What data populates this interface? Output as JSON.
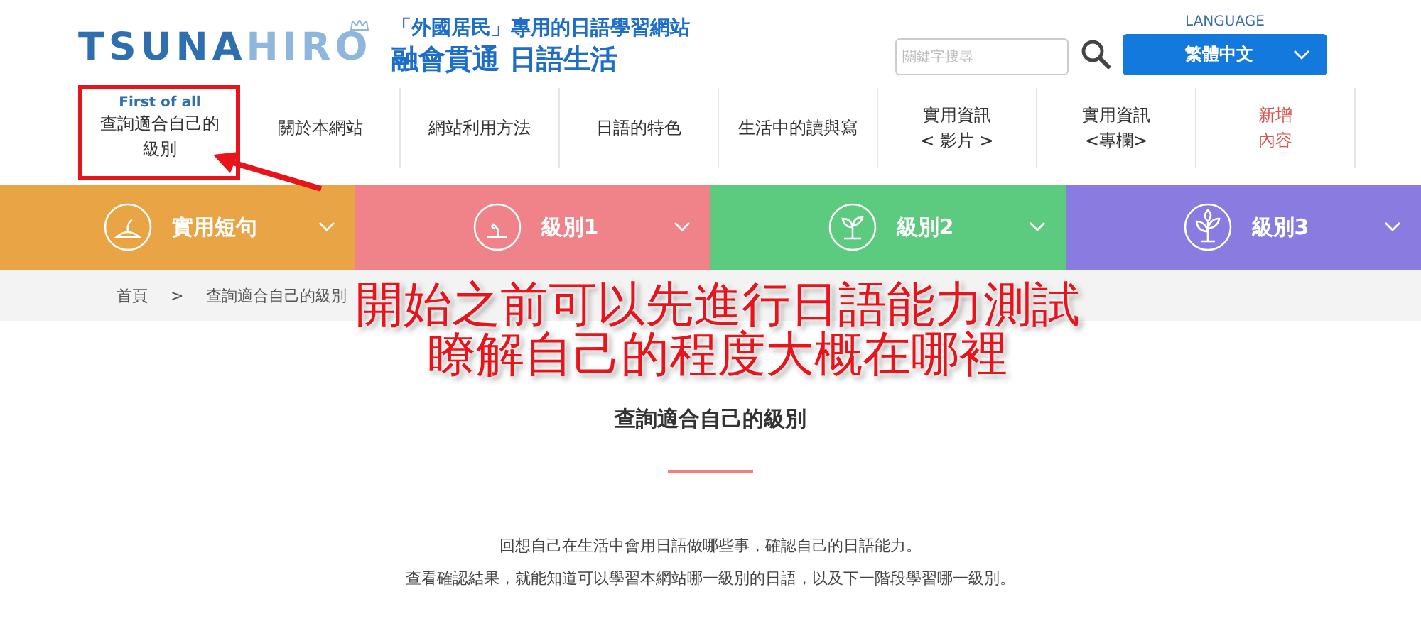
{
  "header": {
    "logo": {
      "main": "TSUNA",
      "accent": "HIRO"
    },
    "tagline": "「外國居民」專用的日語學習網站",
    "slogan": "融會貫通 日語生活",
    "search": {
      "placeholder": "關鍵字搜尋"
    },
    "language": {
      "label": "LANGUAGE",
      "value": "繁體中文"
    }
  },
  "nav": [
    {
      "eyebrow": "First of all",
      "lines": [
        "查詢適合自己的",
        "級別"
      ],
      "accent": false
    },
    {
      "lines": [
        "關於本網站"
      ],
      "accent": false
    },
    {
      "lines": [
        "網站利用方法"
      ],
      "accent": false
    },
    {
      "lines": [
        "日語的特色"
      ],
      "accent": false
    },
    {
      "lines": [
        "生活中的讀與寫"
      ],
      "accent": false
    },
    {
      "lines": [
        "實用資訊",
        "< 影片 >"
      ],
      "accent": false
    },
    {
      "lines": [
        "實用資訊",
        "<專欄>"
      ],
      "accent": false
    },
    {
      "lines": [
        "新增",
        "內容"
      ],
      "accent": true
    }
  ],
  "categories": [
    {
      "label": "實用短句",
      "color": "#e8a445",
      "kind": "seed"
    },
    {
      "label": "級別1",
      "color": "#f0838a",
      "kind": "sprout"
    },
    {
      "label": "級別2",
      "color": "#5ccb7f",
      "kind": "seedling"
    },
    {
      "label": "級別3",
      "color": "#8a7be0",
      "kind": "tree"
    }
  ],
  "breadcrumb": [
    "首頁",
    "查詢適合自己的級別"
  ],
  "breadcrumb_separator": ">",
  "annotation": {
    "caption": [
      "開始之前可以先進行日語能力測試",
      "瞭解自己的程度大概在哪裡"
    ]
  },
  "content": {
    "title": "查詢適合自己的級別",
    "paragraphs": [
      "回想自己在生活中會用日語做哪些事，確認自己的日語能力。",
      "查看確認結果，就能知道可以學習本網站哪一級別的日語，以及下一階段學習哪一級別。"
    ]
  }
}
